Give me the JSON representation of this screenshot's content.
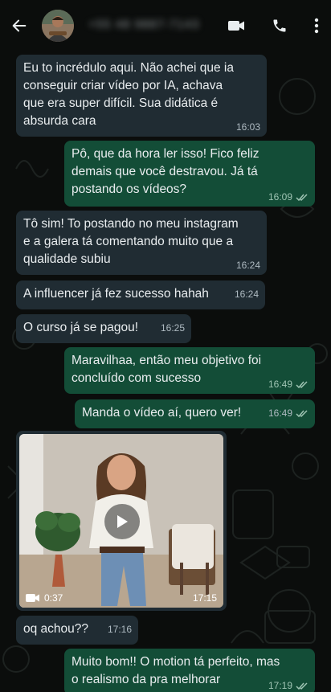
{
  "header": {
    "contact_name": "+55 48 9887-7143",
    "back_icon": "arrow-left-icon",
    "video_call_icon": "video-camera-icon",
    "voice_call_icon": "phone-icon",
    "menu_icon": "kebab-menu-icon"
  },
  "colors": {
    "incoming_bubble": "#202c33",
    "outgoing_bubble": "#134d37",
    "background": "#0b0d0c",
    "read_tick": "#9fc4b3"
  },
  "messages": [
    {
      "direction": "in",
      "text": "Eu to incrédulo aqui. Não achei que ia\nconseguir criar vídeo por IA, achava\nque era super difícil. Sua didática é\nabsurda cara",
      "time": "16:03"
    },
    {
      "direction": "out",
      "text": "Pô, que da hora ler isso! Fico feliz\ndemais que você destravou. Já tá\npostando os vídeos?",
      "time": "16:09"
    },
    {
      "direction": "in",
      "text": "Tô sim! To postando no meu instagram\ne a galera tá comentando muito que a\nqualidade subiu",
      "time": "16:24"
    },
    {
      "direction": "in",
      "text": "A influencer já fez sucesso hahah",
      "time": "16:24"
    },
    {
      "direction": "in",
      "text": "O curso já se pagou!",
      "time": "16:25"
    },
    {
      "direction": "out",
      "text": "Maravilhaa, então meu objetivo foi\nconcluído com sucesso",
      "time": "16:49"
    },
    {
      "direction": "out",
      "text": "Manda o vídeo aí, quero ver!",
      "time": "16:49"
    },
    {
      "direction": "in",
      "type": "video",
      "duration": "0:37",
      "time": "17:15"
    },
    {
      "direction": "in",
      "text": "oq achou??",
      "time": "17:16"
    },
    {
      "direction": "out",
      "text": "Muito bom!! O motion tá perfeito, mas\no realismo da pra melhorar",
      "time": "17:19"
    }
  ]
}
